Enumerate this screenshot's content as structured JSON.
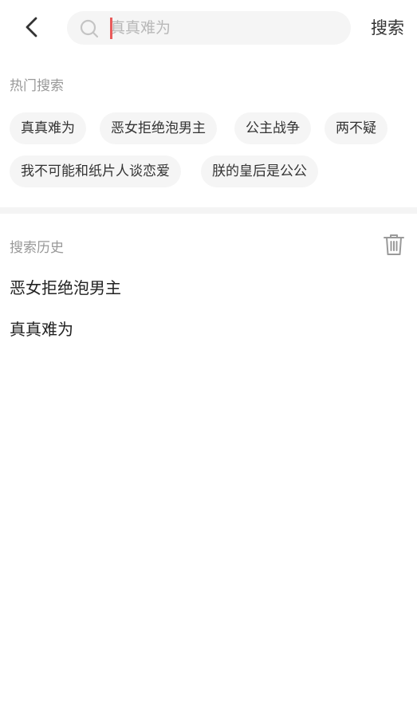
{
  "header": {
    "search_placeholder": "真真难为",
    "search_button": "搜索"
  },
  "hot": {
    "title": "热门搜索",
    "tags": [
      "真真难为",
      "恶女拒绝泡男主",
      "公主战争",
      "两不疑",
      "我不可能和纸片人谈恋爱",
      "朕的皇后是公公"
    ]
  },
  "history": {
    "title": "搜索历史",
    "items": [
      "恶女拒绝泡男主",
      "真真难为"
    ]
  },
  "colors": {
    "accent": "#e85b5b",
    "tag_bg": "#f5f5f5",
    "muted_text": "#999999"
  }
}
